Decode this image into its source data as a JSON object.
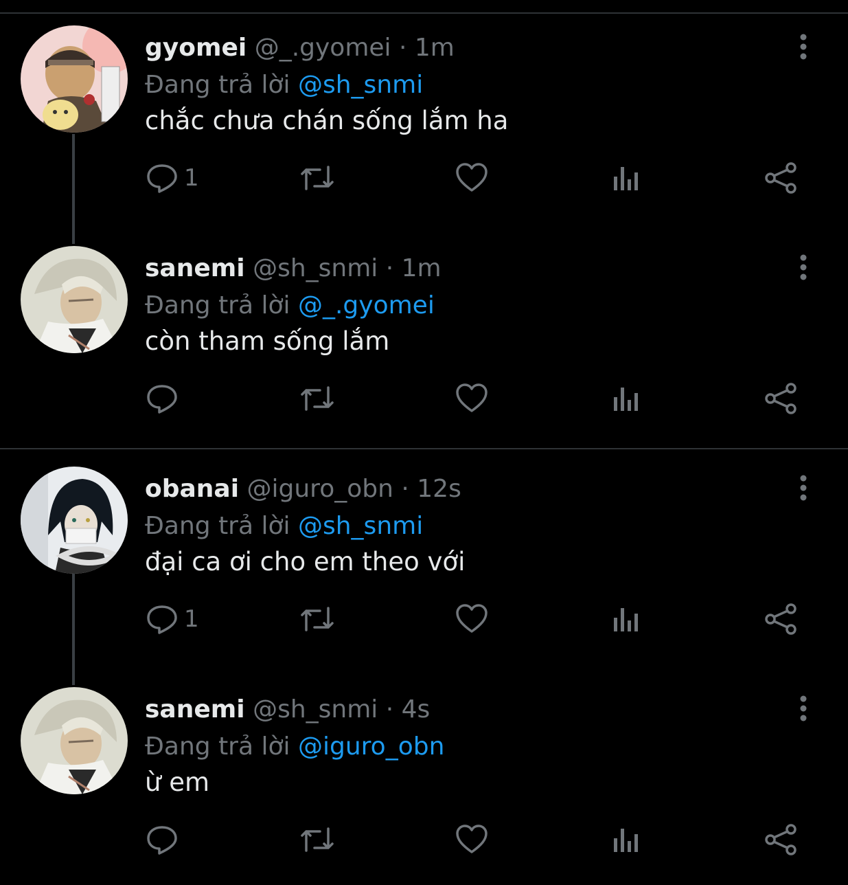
{
  "colors": {
    "background": "#000000",
    "text": "#e7e9ea",
    "muted": "#71767b",
    "accent": "#1d9bf0",
    "divider": "#2f3336"
  },
  "reply_prefix": "Đang trả lời",
  "tweets": [
    {
      "name": "gyomei",
      "handle": "@_.gyomei",
      "time": "· 1m",
      "reply_to": "@sh_snmi",
      "text": "chắc chưa chán sống lắm ha",
      "reply_count": "1",
      "avatar": "gyomei-avatar"
    },
    {
      "name": "sanemi",
      "handle": "@sh_snmi",
      "time": "· 1m",
      "reply_to": "@_.gyomei",
      "text": "còn tham sống lắm",
      "reply_count": "",
      "avatar": "sanemi-avatar"
    },
    {
      "name": "obanai",
      "handle": "@iguro_obn",
      "time": "· 12s",
      "reply_to": "@sh_snmi",
      "text": "đại ca ơi cho em theo với",
      "reply_count": "1",
      "avatar": "obanai-avatar"
    },
    {
      "name": "sanemi",
      "handle": "@sh_snmi",
      "time": "· 4s",
      "reply_to": "@iguro_obn",
      "text": "ừ em",
      "reply_count": "",
      "avatar": "sanemi-avatar"
    }
  ],
  "icons": [
    "reply-icon",
    "retweet-icon",
    "like-icon",
    "analytics-icon",
    "share-icon",
    "more-options-icon"
  ]
}
